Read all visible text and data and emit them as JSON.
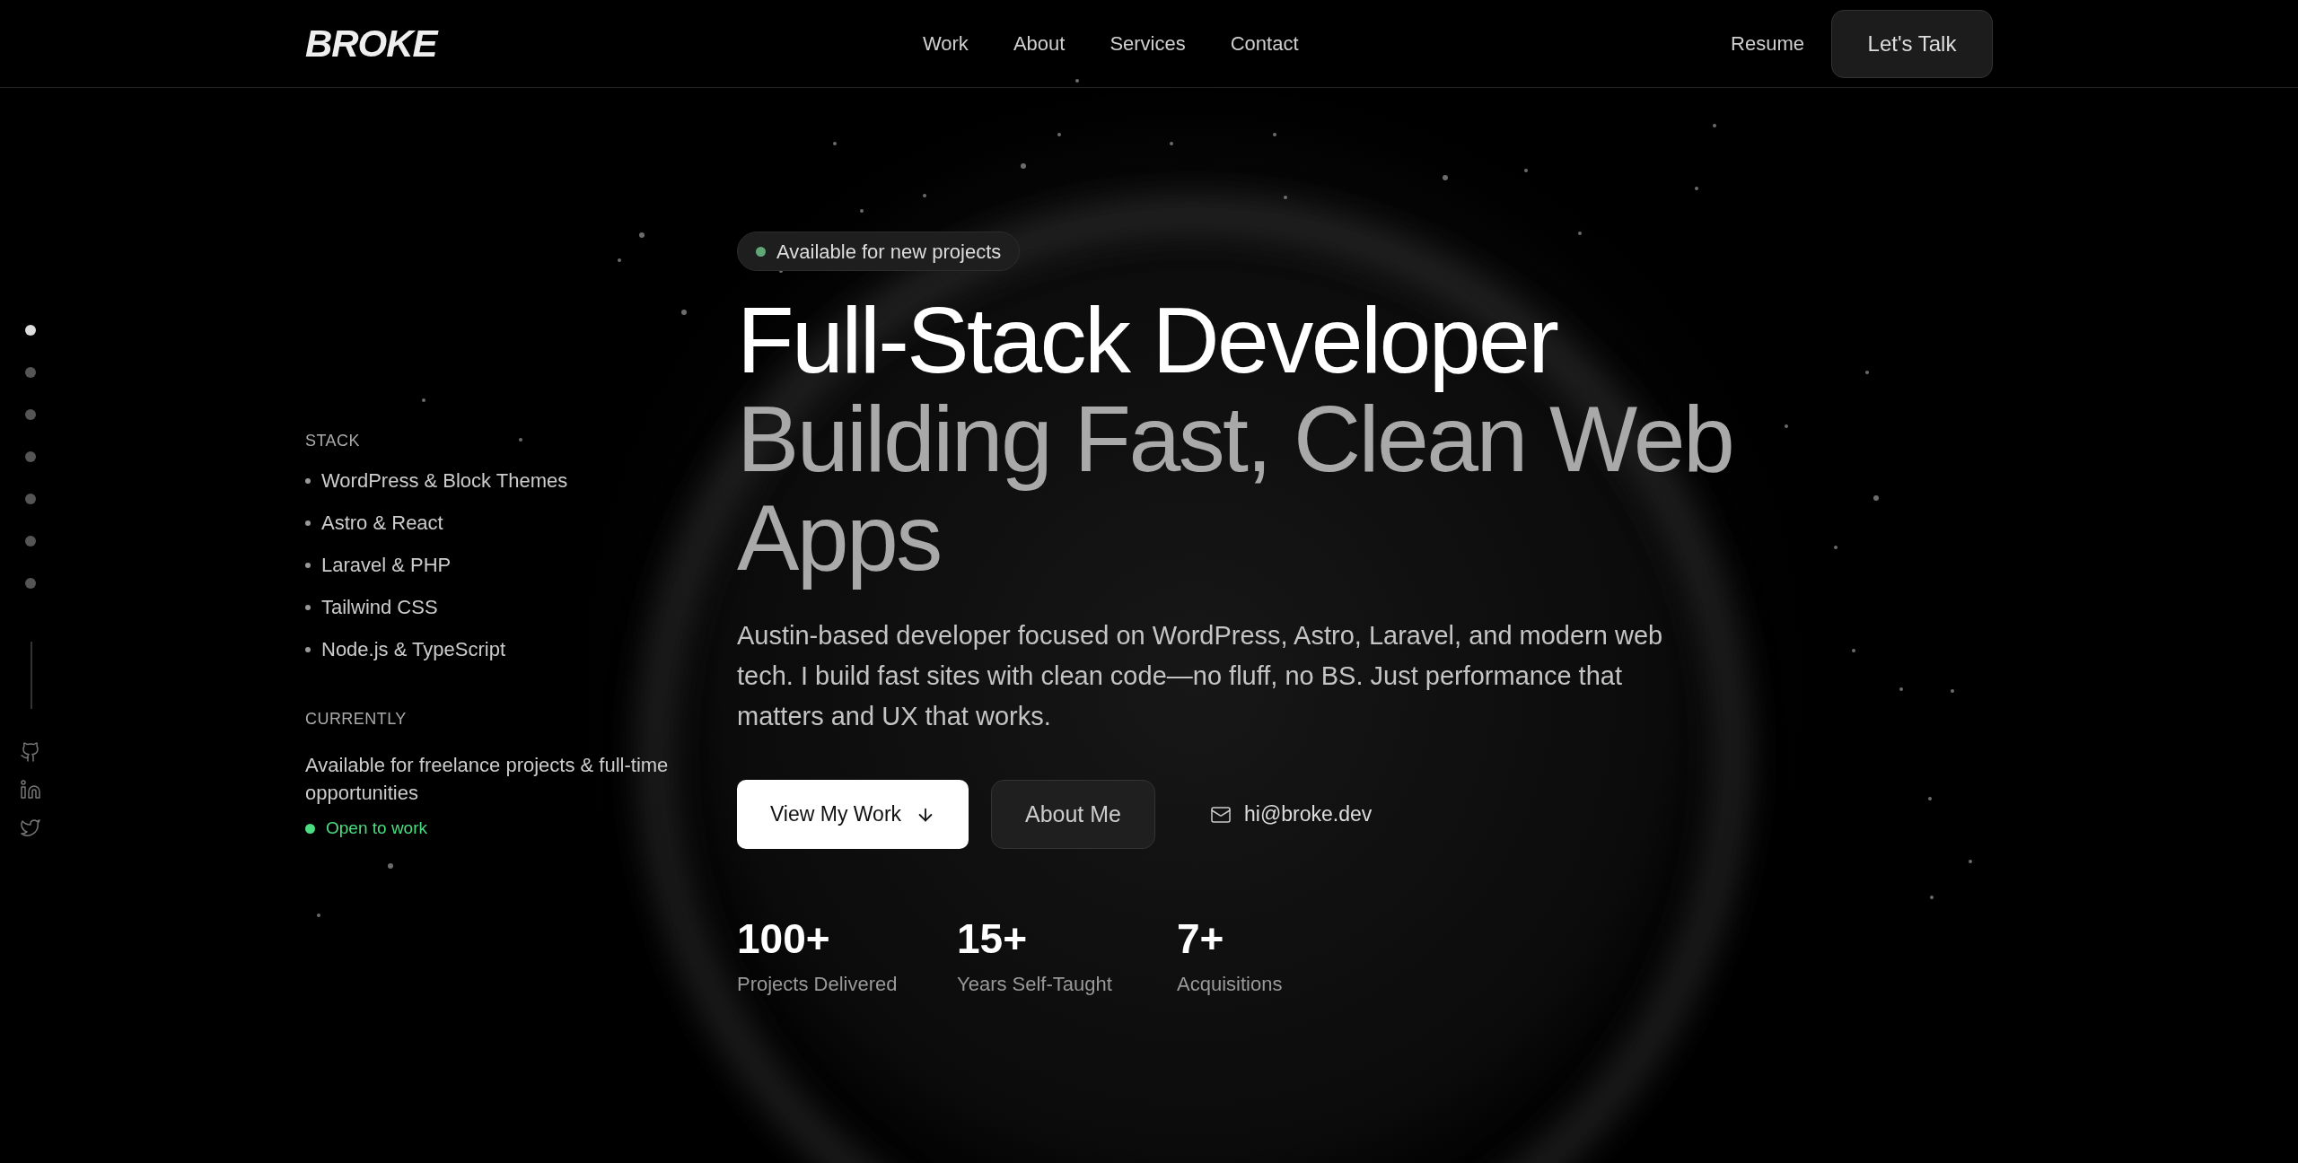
{
  "nav": {
    "logo": "BROKE",
    "links": [
      "Work",
      "About",
      "Services",
      "Contact"
    ],
    "resume": "Resume",
    "cta": "Let's Talk"
  },
  "rail": {
    "dots": [
      {
        "selected": true
      },
      {
        "selected": false
      },
      {
        "selected": false
      },
      {
        "selected": false
      },
      {
        "selected": false
      },
      {
        "selected": false
      },
      {
        "selected": false
      }
    ]
  },
  "sidebar": {
    "stack_title": "STACK",
    "stack": [
      "WordPress & Block Themes",
      "Astro & React",
      "Laravel & PHP",
      "Tailwind CSS",
      "Node.js & TypeScript"
    ],
    "currently_title": "CURRENTLY",
    "currently": "Available for freelance projects & full-time opportunities",
    "status": {
      "label": "Open to work",
      "color": "#4ade80"
    }
  },
  "hero": {
    "badge": {
      "label": "Available for new projects",
      "color": "#5fa777"
    },
    "title": "Full-Stack Developer",
    "subtitle": "Building Fast, Clean Web Apps",
    "description": "Austin-based developer focused on WordPress, Astro, Laravel, and modern web tech. I build fast sites with clean code—no fluff, no BS. Just performance that matters and UX that works.",
    "primary_button": "View My Work",
    "secondary_button": "About Me",
    "email": "hi@broke.dev",
    "stats": [
      {
        "value": "100+",
        "label": "Projects Delivered"
      },
      {
        "value": "15+",
        "label": "Years Self-Taught"
      },
      {
        "value": "7+",
        "label": "Acquisitions"
      }
    ]
  }
}
